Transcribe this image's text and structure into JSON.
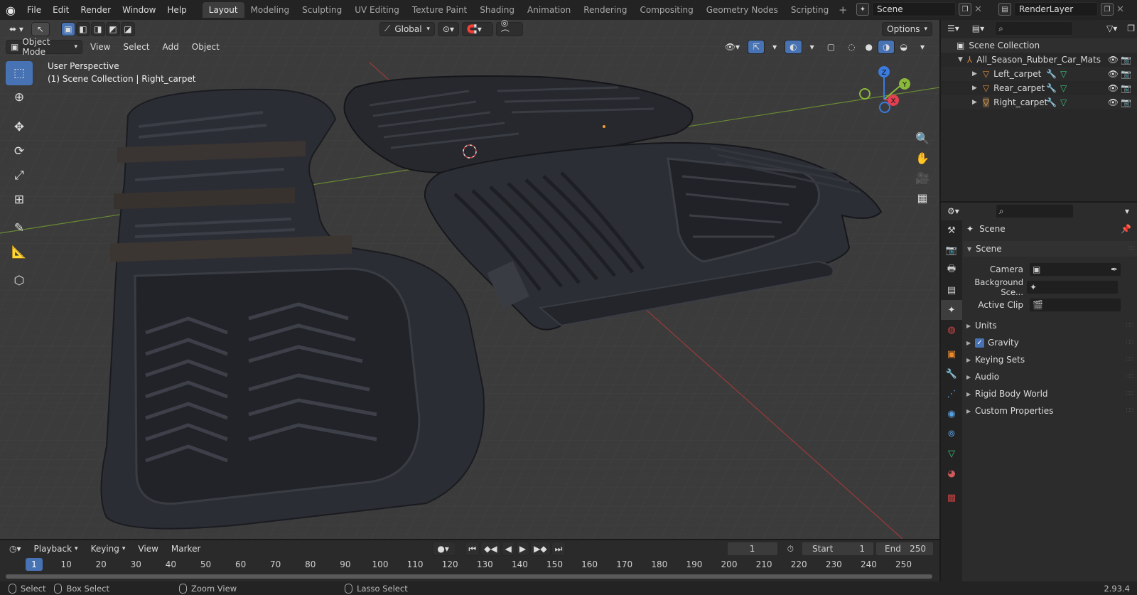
{
  "menu": {
    "file": "File",
    "edit": "Edit",
    "render": "Render",
    "window": "Window",
    "help": "Help"
  },
  "workspaces": [
    "Layout",
    "Modeling",
    "Sculpting",
    "UV Editing",
    "Texture Paint",
    "Shading",
    "Animation",
    "Rendering",
    "Compositing",
    "Geometry Nodes",
    "Scripting"
  ],
  "active_workspace": "Layout",
  "scene_name": "Scene",
  "view_layer": "RenderLayer",
  "viewport": {
    "transform_orientation": "Global",
    "options_label": "Options",
    "mode": "Object Mode",
    "menus": [
      "View",
      "Select",
      "Add",
      "Object"
    ],
    "overlay_line1": "User Perspective",
    "overlay_line2": "(1) Scene Collection | Right_carpet",
    "gizmo_axes": {
      "z": "Z",
      "y": "Y",
      "x": "X"
    }
  },
  "outliner": {
    "root": "Scene Collection",
    "collection": "All_Season_Rubber_Car_Mats",
    "objects": [
      "Left_carpet",
      "Rear_carpet",
      "Right_carpet"
    ]
  },
  "properties": {
    "context": "Scene",
    "panel_title": "Scene",
    "fields": [
      {
        "label": "Camera",
        "value": ""
      },
      {
        "label": "Background Sce...",
        "value": ""
      },
      {
        "label": "Active Clip",
        "value": ""
      }
    ],
    "subpanels": [
      "Units",
      "Gravity",
      "Keying Sets",
      "Audio",
      "Rigid Body World",
      "Custom Properties"
    ]
  },
  "timeline": {
    "menus": [
      "Playback",
      "Keying",
      "View",
      "Marker"
    ],
    "current_frame": "1",
    "start_label": "Start",
    "start": "1",
    "end_label": "End",
    "end": "250",
    "ruler": [
      "1",
      "10",
      "20",
      "30",
      "40",
      "50",
      "60",
      "70",
      "80",
      "90",
      "100",
      "110",
      "120",
      "130",
      "140",
      "150",
      "160",
      "170",
      "180",
      "190",
      "200",
      "210",
      "220",
      "230",
      "240",
      "250"
    ]
  },
  "statusbar": {
    "select": "Select",
    "box_select": "Box Select",
    "zoom_view": "Zoom View",
    "lasso_select": "Lasso Select",
    "version": "2.93.4"
  }
}
